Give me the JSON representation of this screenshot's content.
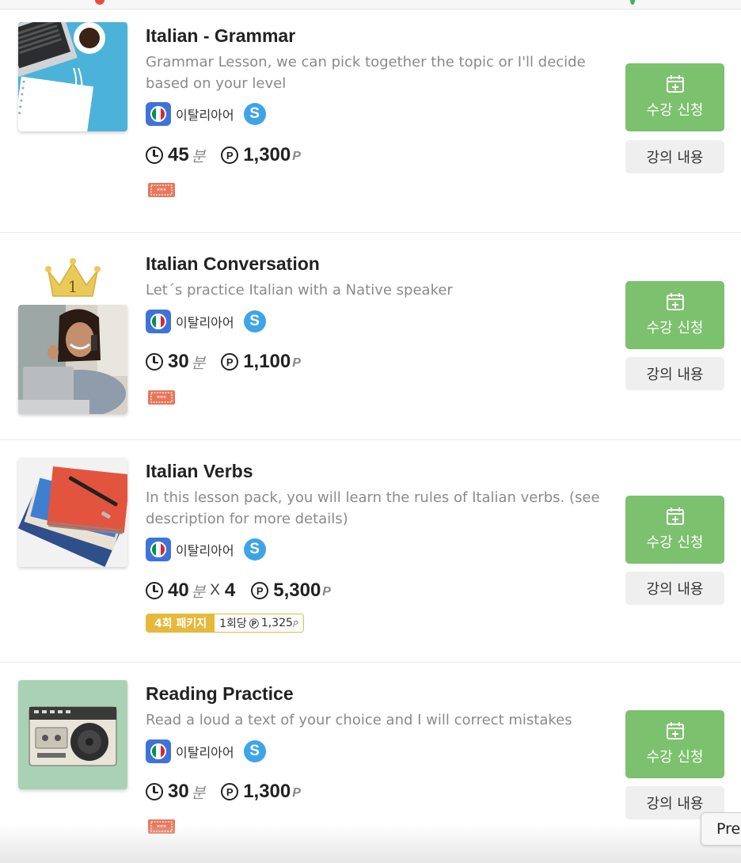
{
  "colors": {
    "enroll_green": "#7cc16d",
    "detail_gray": "#efefef",
    "title_text": "#222222",
    "desc_text": "#8a8a8a",
    "italy_green": "#009246",
    "italy_white": "#ffffff",
    "italy_red": "#ce2b37",
    "skype_blue": "#3ea4e8",
    "package_gold": "#e6b83c",
    "ticket_red": "#e8765a"
  },
  "lessons": [
    {
      "title": "Italian - Grammar",
      "description": "Grammar Lesson, we can pick together the topic or I'll decide based on your level",
      "language": "이탈리아어",
      "platform_icon": "skype-icon",
      "duration_value": "45",
      "duration_unit": "분",
      "price": "1,300",
      "price_unit": "P",
      "enroll_label": "수강 신청",
      "detail_label": "강의 내용",
      "thumbnail": "laptop-coffee-notebook-image",
      "badge_icon": "ticket-icon"
    },
    {
      "title": "Italian Conversation",
      "description": "Let´s practice Italian with a Native speaker",
      "language": "이탈리아어",
      "platform_icon": "skype-icon",
      "duration_value": "30",
      "duration_unit": "분",
      "price": "1,100",
      "price_unit": "P",
      "enroll_label": "수강 신청",
      "detail_label": "강의 내용",
      "rank": "1",
      "thumbnail": "woman-on-phone-image",
      "badge_icon": "ticket-icon"
    },
    {
      "title": "Italian Verbs",
      "description": "In this lesson pack, you will learn the rules of Italian verbs. (see description for more details)",
      "language": "이탈리아어",
      "platform_icon": "skype-icon",
      "duration_value": "40",
      "duration_unit": "분",
      "multiplier": "X",
      "sessions": "4",
      "price": "5,300",
      "price_unit": "P",
      "package_label": "4회 패키지",
      "per_session_label": "1회당",
      "per_session_price": "1,325",
      "per_session_unit": "P",
      "enroll_label": "수강 신청",
      "detail_label": "강의 내용",
      "thumbnail": "notebooks-pen-image"
    },
    {
      "title": "Reading Practice",
      "description": "Read a loud a text of your choice and I will correct mistakes",
      "language": "이탈리아어",
      "platform_icon": "skype-icon",
      "duration_value": "30",
      "duration_unit": "분",
      "price": "1,300",
      "price_unit": "P",
      "enroll_label": "수강 신청",
      "detail_label": "강의 내용",
      "thumbnail": "cassette-radio-image",
      "badge_icon": "ticket-icon"
    }
  ],
  "pager": {
    "prev_label": "Pre"
  }
}
